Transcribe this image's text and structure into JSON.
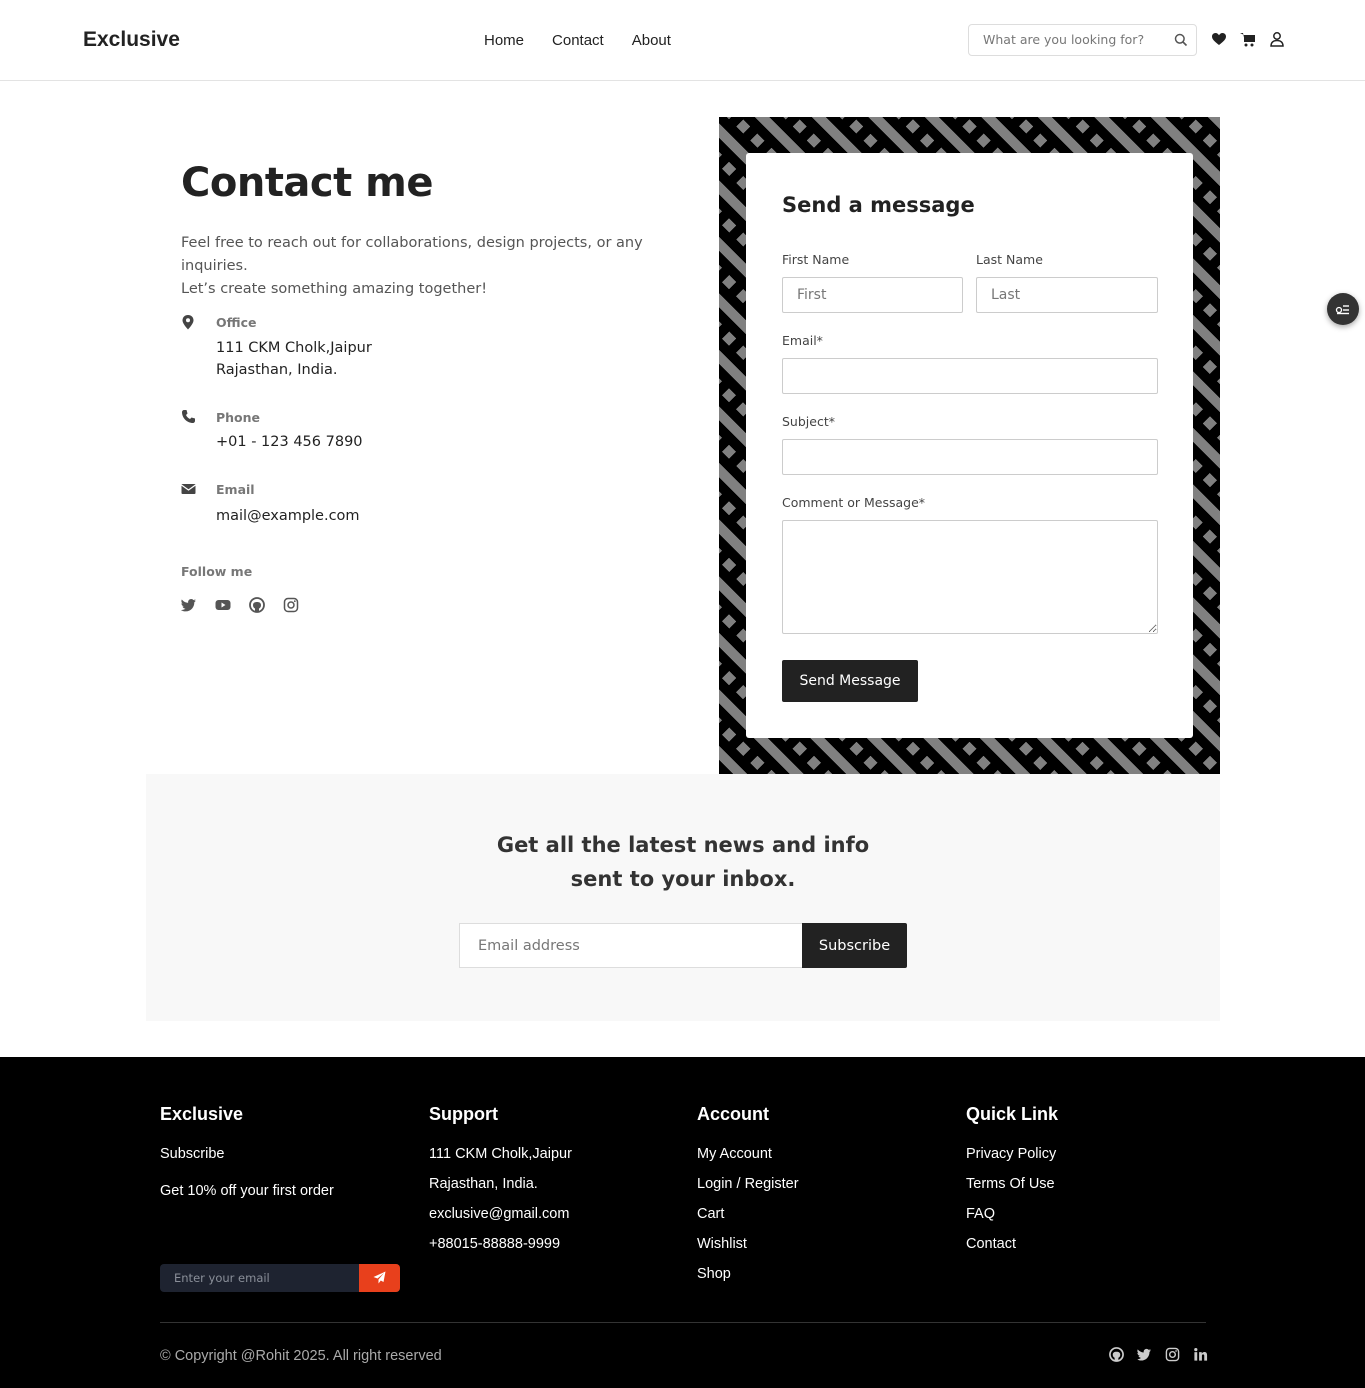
{
  "header": {
    "logo": "Exclusive",
    "nav": [
      "Home",
      "Contact",
      "About"
    ],
    "search_placeholder": "What are you looking for?"
  },
  "contact": {
    "title": "Contact me",
    "intro_line1": "Feel free to reach out for collaborations, design projects, or any inquiries.",
    "intro_line2": "Let’s create something amazing together!",
    "office_label": "Office",
    "office_line1": "111 CKM Cholk,Jaipur",
    "office_line2": "Rajasthan, India.",
    "phone_label": "Phone",
    "phone_value": "+01 - 123 456 7890",
    "email_label": "Email",
    "email_value": "mail@example.com",
    "follow_label": "Follow me"
  },
  "form": {
    "title": "Send a message",
    "first_name_label": "First Name",
    "first_name_placeholder": "First",
    "last_name_label": "Last Name",
    "last_name_placeholder": "Last",
    "email_label": "Email*",
    "subject_label": "Subject*",
    "message_label": "Comment or Message*",
    "submit_label": "Send Message"
  },
  "newsletter": {
    "title_line1": "Get all the latest news and info",
    "title_line2": "sent to your inbox.",
    "email_placeholder": "Email address",
    "button_label": "Subscribe"
  },
  "footer": {
    "col1": {
      "title": "Exclusive",
      "subscribe": "Subscribe",
      "offer": "Get 10% off your first order",
      "email_placeholder": "Enter your email"
    },
    "col2": {
      "title": "Support",
      "items": [
        "111 CKM Cholk,Jaipur",
        "Rajasthan, India.",
        "exclusive@gmail.com",
        "+88015-88888-9999"
      ]
    },
    "col3": {
      "title": "Account",
      "items": [
        "My Account",
        "Login / Register",
        "Cart",
        "Wishlist",
        "Shop"
      ]
    },
    "col4": {
      "title": "Quick Link",
      "items": [
        "Privacy Policy",
        "Terms Of Use",
        "FAQ",
        "Contact"
      ]
    },
    "copyright": "© Copyright @Rohit 2025. All right reserved"
  },
  "colors": {
    "accent": "#e8401c",
    "dark": "#222222",
    "footer_bg": "#000000"
  }
}
